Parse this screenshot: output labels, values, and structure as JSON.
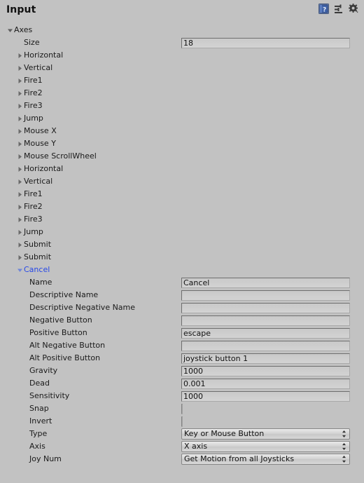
{
  "window": {
    "title": "Input",
    "background_color": "#c2c2c2",
    "selected_color": "#2748e8"
  },
  "header": {
    "icons": [
      {
        "name": "help-icon",
        "label": "Help"
      },
      {
        "name": "preset-icon",
        "label": "Preset"
      },
      {
        "name": "gear-icon",
        "label": "Settings"
      }
    ]
  },
  "tree": {
    "root": {
      "label": "Axes",
      "expanded": true
    },
    "size": {
      "label": "Size",
      "value": "18"
    },
    "items": [
      {
        "label": "Horizontal",
        "expanded": false,
        "selected": false
      },
      {
        "label": "Vertical",
        "expanded": false,
        "selected": false
      },
      {
        "label": "Fire1",
        "expanded": false,
        "selected": false
      },
      {
        "label": "Fire2",
        "expanded": false,
        "selected": false
      },
      {
        "label": "Fire3",
        "expanded": false,
        "selected": false
      },
      {
        "label": "Jump",
        "expanded": false,
        "selected": false
      },
      {
        "label": "Mouse X",
        "expanded": false,
        "selected": false
      },
      {
        "label": "Mouse Y",
        "expanded": false,
        "selected": false
      },
      {
        "label": "Mouse ScrollWheel",
        "expanded": false,
        "selected": false
      },
      {
        "label": "Horizontal",
        "expanded": false,
        "selected": false
      },
      {
        "label": "Vertical",
        "expanded": false,
        "selected": false
      },
      {
        "label": "Fire1",
        "expanded": false,
        "selected": false
      },
      {
        "label": "Fire2",
        "expanded": false,
        "selected": false
      },
      {
        "label": "Fire3",
        "expanded": false,
        "selected": false
      },
      {
        "label": "Jump",
        "expanded": false,
        "selected": false
      },
      {
        "label": "Submit",
        "expanded": false,
        "selected": false
      },
      {
        "label": "Submit",
        "expanded": false,
        "selected": false
      },
      {
        "label": "Cancel",
        "expanded": true,
        "selected": true
      }
    ]
  },
  "properties": [
    {
      "label": "Name",
      "type": "text",
      "value": "Cancel"
    },
    {
      "label": "Descriptive Name",
      "type": "text",
      "value": ""
    },
    {
      "label": "Descriptive Negative Name",
      "type": "text",
      "value": ""
    },
    {
      "label": "Negative Button",
      "type": "text",
      "value": ""
    },
    {
      "label": "Positive Button",
      "type": "text",
      "value": "escape"
    },
    {
      "label": "Alt Negative Button",
      "type": "text",
      "value": ""
    },
    {
      "label": "Alt Positive Button",
      "type": "text",
      "value": "joystick button 1"
    },
    {
      "label": "Gravity",
      "type": "text",
      "value": "1000"
    },
    {
      "label": "Dead",
      "type": "text",
      "value": "0.001"
    },
    {
      "label": "Sensitivity",
      "type": "text",
      "value": "1000"
    },
    {
      "label": "Snap",
      "type": "checkbox",
      "value": false
    },
    {
      "label": "Invert",
      "type": "checkbox",
      "value": false
    },
    {
      "label": "Type",
      "type": "dropdown",
      "value": "Key or Mouse Button"
    },
    {
      "label": "Axis",
      "type": "dropdown",
      "value": "X axis"
    },
    {
      "label": "Joy Num",
      "type": "dropdown",
      "value": "Get Motion from all Joysticks"
    }
  ]
}
